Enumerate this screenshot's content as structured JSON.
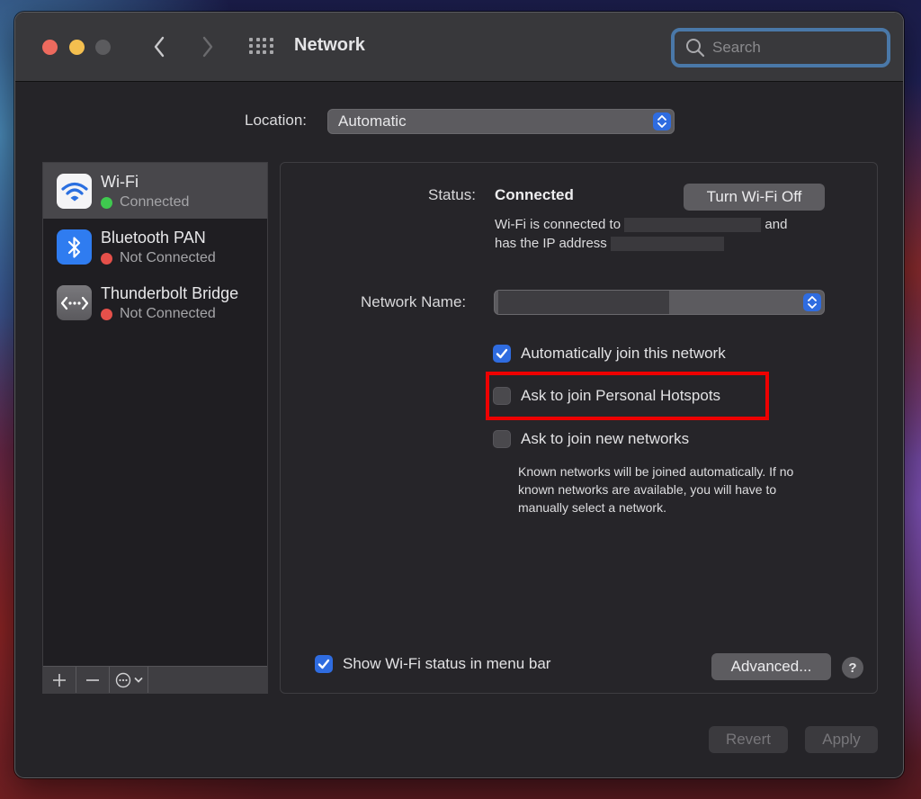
{
  "window": {
    "title": "Network",
    "controls": [
      "close",
      "minimize",
      "maximize"
    ],
    "nav": {
      "back_icon": "chevron-left-icon",
      "forward_icon": "chevron-right-icon",
      "grid_icon": "show-all-grid-icon"
    }
  },
  "search": {
    "placeholder": "Search",
    "value": ""
  },
  "location": {
    "label": "Location:",
    "value": "Automatic"
  },
  "services": [
    {
      "name": "Wi-Fi",
      "status": "Connected",
      "status_color": "#3fc94f",
      "icon": "wifi-icon",
      "selected": true
    },
    {
      "name": "Bluetooth PAN",
      "status": "Not Connected",
      "status_color": "#e5504a",
      "icon": "bluetooth-icon",
      "selected": false
    },
    {
      "name": "Thunderbolt Bridge",
      "status": "Not Connected",
      "status_color": "#e5504a",
      "icon": "thunderbolt-bridge-icon",
      "selected": false
    }
  ],
  "sidebar_toolbar": {
    "add": "+",
    "remove": "−",
    "action": "⋯"
  },
  "detail": {
    "status_label": "Status:",
    "status_value": "Connected",
    "turn_off_label": "Turn Wi-Fi Off",
    "conn_text_1": "Wi-Fi is connected to",
    "conn_text_2": "and",
    "conn_text_3": "has the IP address",
    "network_name_label": "Network Name:",
    "checkboxes": [
      {
        "label": "Automatically join this network",
        "checked": true
      },
      {
        "label": "Ask to join Personal Hotspots",
        "checked": false,
        "highlighted": true
      },
      {
        "label": "Ask to join new networks",
        "checked": false
      }
    ],
    "known_networks_text": "Known networks will be joined automatically. If no known networks are available, you will have to manually select a network.",
    "show_status": {
      "label": "Show Wi-Fi status in menu bar",
      "checked": true
    },
    "advanced_label": "Advanced...",
    "help_label": "?"
  },
  "footer": {
    "revert_label": "Revert",
    "apply_label": "Apply"
  },
  "colors": {
    "accent": "#2f6ce0",
    "highlight_box": "#ee0000",
    "search_focus": "#4a78a8"
  }
}
